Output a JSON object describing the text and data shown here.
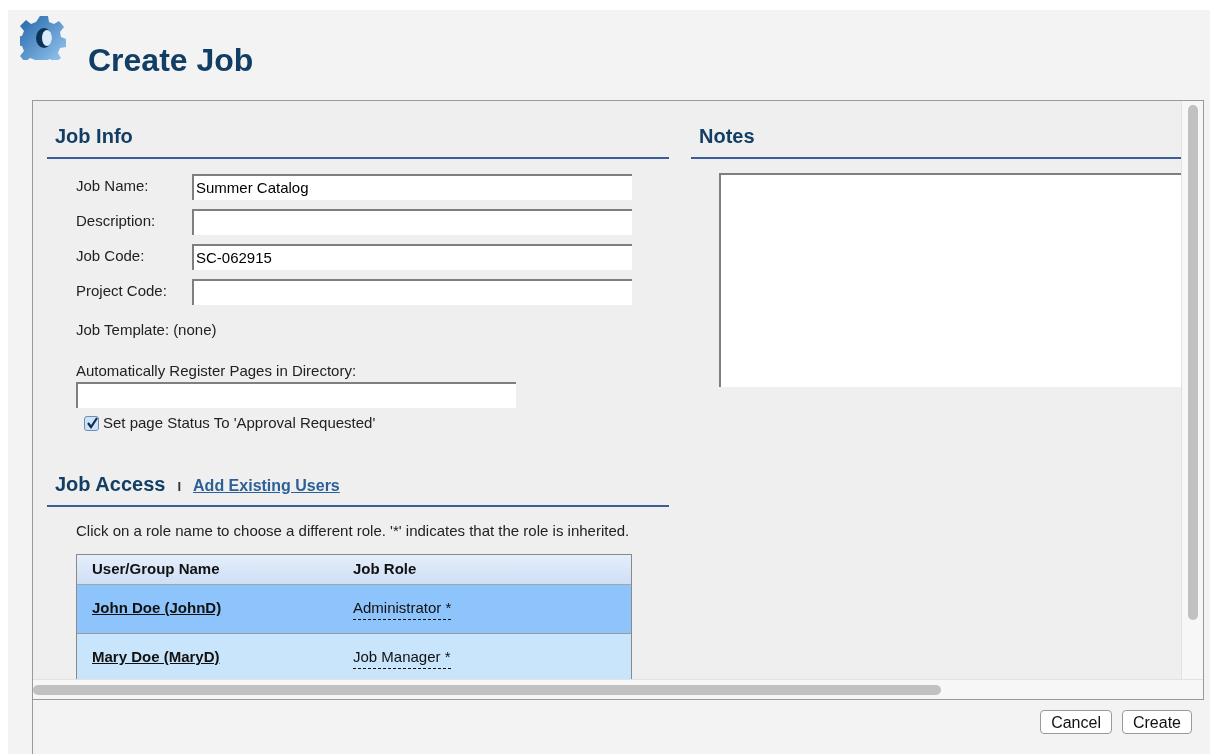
{
  "page": {
    "title": "Create Job"
  },
  "job_info": {
    "heading": "Job Info",
    "fields": [
      {
        "label": "Job Name:",
        "value": "Summer Catalog"
      },
      {
        "label": "Description:"
      },
      {
        "label": "Job Code:",
        "value": "SC-062915"
      },
      {
        "label": "Project Code:"
      }
    ],
    "template": {
      "label": "Job Template:",
      "value": "(none)"
    },
    "register": {
      "label": "Automatically Register Pages in Directory:"
    },
    "status_checkbox": {
      "label": "Set page Status To 'Approval Requested'",
      "checked": true
    }
  },
  "notes": {
    "heading": "Notes"
  },
  "job_access": {
    "heading": "Job Access",
    "separator": "I",
    "link": "Add Existing Users",
    "hint": "Click on a role name to choose a different role. '*' indicates that the role is inherited.",
    "table": {
      "columns": [
        "User/Group Name",
        "Job Role"
      ],
      "rows": [
        {
          "name": "John Doe (JohnD)",
          "role": "Administrator *",
          "selected": true
        },
        {
          "name": "Mary Doe (MaryD)",
          "role": "Job Manager *",
          "selected": false
        }
      ]
    }
  },
  "buttons": [
    "Cancel",
    "Create"
  ]
}
